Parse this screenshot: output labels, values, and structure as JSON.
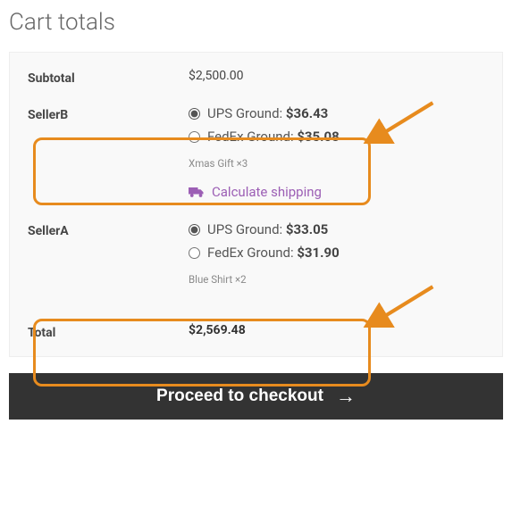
{
  "title": "Cart totals",
  "subtotal": {
    "label": "Subtotal",
    "value": "$2,500.00"
  },
  "sellers": [
    {
      "name": "SellerB",
      "options": [
        {
          "label": "UPS Ground:",
          "price": "$36.43",
          "selected": true
        },
        {
          "label": "FedEx Ground:",
          "price": "$35.08",
          "selected": false
        }
      ],
      "items_note": "Xmas Gift ×3",
      "show_calc_link": true
    },
    {
      "name": "SellerA",
      "options": [
        {
          "label": "UPS Ground:",
          "price": "$33.05",
          "selected": true
        },
        {
          "label": "FedEx Ground:",
          "price": "$31.90",
          "selected": false
        }
      ],
      "items_note": "Blue Shirt ×2",
      "show_calc_link": false
    }
  ],
  "calc_link_text": "Calculate shipping",
  "total": {
    "label": "Total",
    "value": "$2,569.48"
  },
  "checkout_label": "Proceed to checkout",
  "colors": {
    "highlight": "#e78b1e",
    "link": "#9c5fb5",
    "checkout_bg": "#333333"
  }
}
